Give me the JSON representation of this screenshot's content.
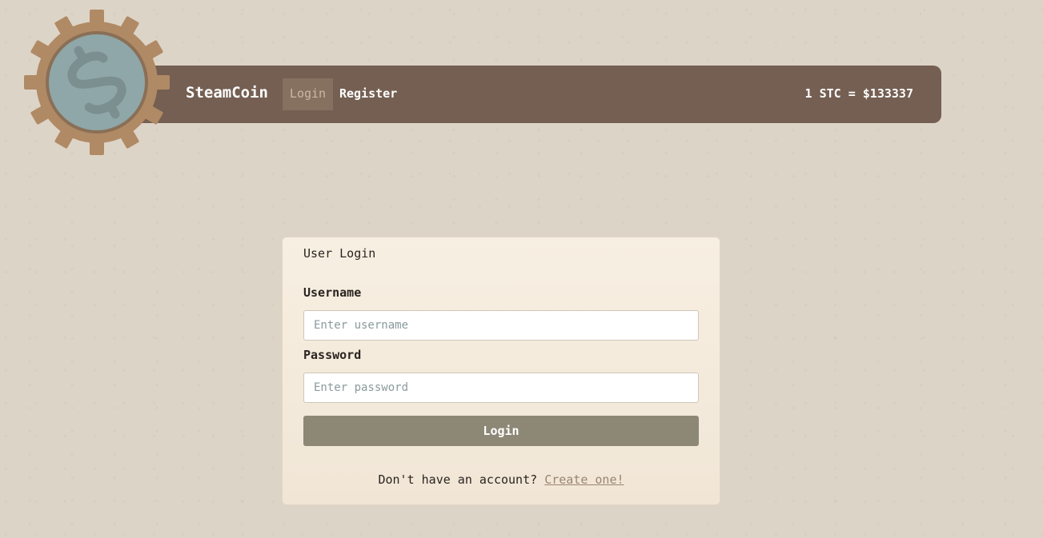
{
  "header": {
    "brand": "SteamCoin",
    "nav": {
      "login": "Login",
      "register": "Register"
    },
    "price": "1 STC = $133337"
  },
  "logo": {
    "icon": "dollar-gear-icon",
    "gear_color": "#b08a65",
    "coin_color": "#8fa7a8"
  },
  "login_card": {
    "title": "User Login",
    "username_label": "Username",
    "username_placeholder": "Enter username",
    "username_value": "",
    "password_label": "Password",
    "password_placeholder": "Enter password",
    "password_value": "",
    "submit_label": "Login",
    "signup_prompt": "Don't have an account?",
    "signup_link": "Create one!"
  },
  "colors": {
    "navbar": "#745f52",
    "button": "#8d8876",
    "card": "#f4eadc"
  }
}
